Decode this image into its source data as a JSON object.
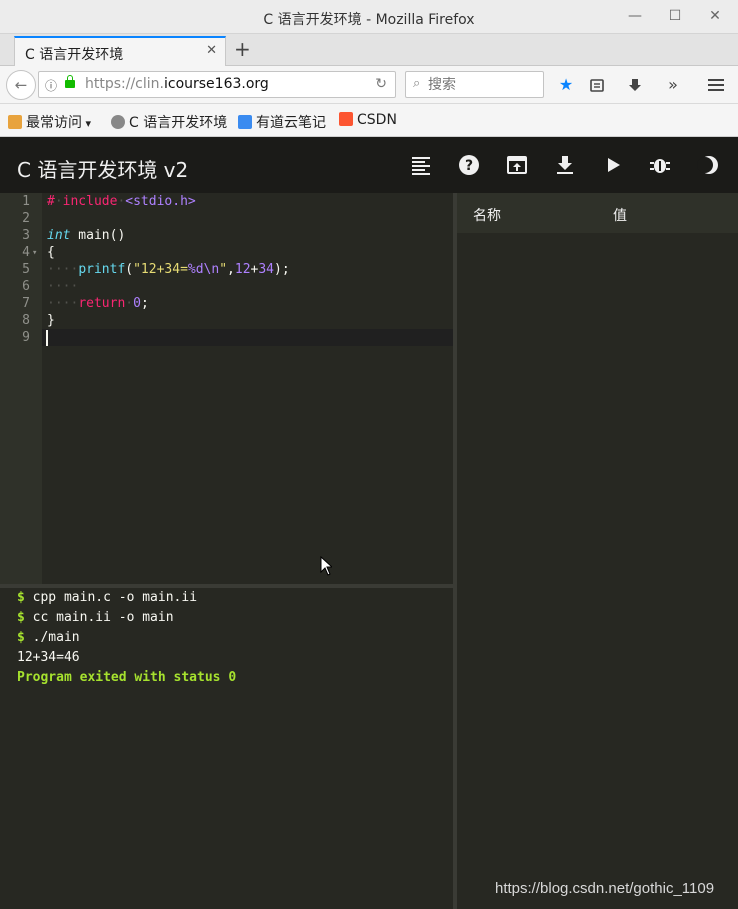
{
  "window": {
    "title": "C 语言开发环境 - Mozilla Firefox"
  },
  "tab": {
    "label": "C 语言开发环境"
  },
  "nav": {
    "url_prefix": "https://clin.",
    "url_domain": "icourse163.org",
    "search_placeholder": "搜索"
  },
  "bookmarks": [
    {
      "label": "最常访问",
      "icon": "folder-icon",
      "color": "#e8a33d"
    },
    {
      "label": "C 语言开发环境",
      "icon": "globe-icon",
      "color": "#888888"
    },
    {
      "label": "有道云笔记",
      "icon": "youdao-note-icon",
      "color": "#3a8bf0"
    },
    {
      "label": "CSDN",
      "icon": "csdn-icon",
      "color": "#fc5531"
    }
  ],
  "app": {
    "title": "C 语言开发环境 v2"
  },
  "editor": {
    "line_numbers": [
      "1",
      "2",
      "3",
      "4",
      "5",
      "6",
      "7",
      "8",
      "9"
    ],
    "active_line": "9"
  },
  "terminal": {
    "lines": [
      {
        "prompt": "$",
        "text": " cpp main.c -o main.ii"
      },
      {
        "prompt": "$",
        "text": " cc main.ii -o main"
      },
      {
        "prompt": "$",
        "text": " ./main"
      }
    ],
    "output": "12+34=46",
    "exit_message": "Program exited with status 0"
  },
  "vars": {
    "col_name": "名称",
    "col_value": "值"
  },
  "watermark": "https://blog.csdn.net/gothic_1109",
  "colors": {
    "accent": "#0a84ff",
    "prompt": "#a6e22e",
    "keyword": "#f92672",
    "string": "#e6db74",
    "number": "#ae81ff"
  }
}
